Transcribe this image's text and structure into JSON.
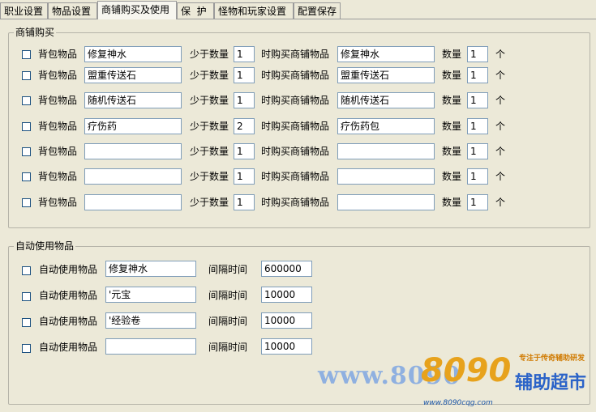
{
  "tabs": [
    {
      "label": "职业设置"
    },
    {
      "label": "物品设置"
    },
    {
      "label": "商铺购买及使用"
    },
    {
      "label": "保  护"
    },
    {
      "label": "怪物和玩家设置"
    },
    {
      "label": "配置保存"
    }
  ],
  "shop": {
    "title": "商铺购买",
    "bag_label": "背包物品",
    "less_label": "少于数量",
    "buy_label": "时购买商铺物品",
    "qty_label": "数量",
    "unit_label": "个",
    "rows": [
      {
        "bag": "修复神水",
        "min": "1",
        "buy": "修复神水",
        "qty": "1"
      },
      {
        "bag": "盟重传送石",
        "min": "1",
        "buy": "盟重传送石",
        "qty": "1"
      },
      {
        "bag": "随机传送石",
        "min": "1",
        "buy": "随机传送石",
        "qty": "1"
      },
      {
        "bag": "疗伤药",
        "min": "2",
        "buy": "疗伤药包",
        "qty": "1"
      },
      {
        "bag": "",
        "min": "1",
        "buy": "",
        "qty": "1"
      },
      {
        "bag": "",
        "min": "1",
        "buy": "",
        "qty": "1"
      },
      {
        "bag": "",
        "min": "1",
        "buy": "",
        "qty": "1"
      }
    ]
  },
  "auto": {
    "title": "自动使用物品",
    "use_label": "自动使用物品",
    "interval_label": "间隔时间",
    "rows": [
      {
        "item": "修复神水",
        "interval": "600000"
      },
      {
        "item": "'元宝",
        "interval": "10000"
      },
      {
        "item": "'经验卷",
        "interval": "10000"
      },
      {
        "item": "",
        "interval": "10000"
      }
    ]
  },
  "watermark": {
    "url": "www.8090",
    "logo": "8090",
    "tagline": "专注于传奇辅助研发",
    "title": "辅助超市",
    "site": "www.8090cqg.com"
  }
}
